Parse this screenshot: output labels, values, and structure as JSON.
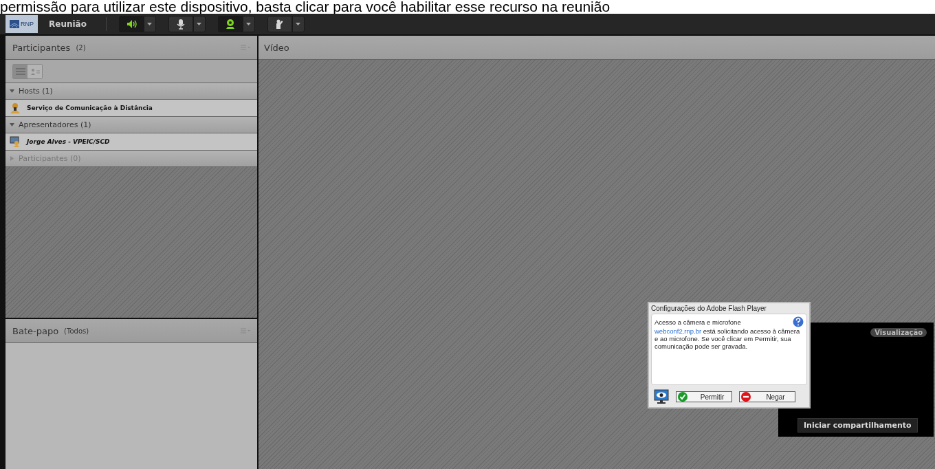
{
  "banner": "permissão para utilizar este dispositivo, basta clicar para você habilitar esse recurso na reunião",
  "toolbar": {
    "logo": "RNP",
    "menu": "Reunião",
    "buttons": [
      {
        "kind": "speaker",
        "on": true
      },
      {
        "kind": "mic",
        "on": false
      },
      {
        "kind": "camera",
        "on": true
      },
      {
        "kind": "hand",
        "on": false
      }
    ]
  },
  "participants": {
    "title": "Participantes",
    "count": "(2)",
    "view_toggle": [
      {
        "kind": "list",
        "selected": true
      },
      {
        "kind": "card",
        "selected": false
      }
    ],
    "groups": [
      {
        "label": "Hosts (1)",
        "expanded": true,
        "members": [
          {
            "name": "Serviço de Comunicação à Distância",
            "kind": "host",
            "italic": false
          }
        ]
      },
      {
        "label": "Apresentadores (1)",
        "expanded": true,
        "members": [
          {
            "name": "Jorge Alves - VPEIC/SCD",
            "kind": "presenter",
            "italic": true
          }
        ]
      },
      {
        "label": "Participantes (0)",
        "expanded": false
      }
    ]
  },
  "chat": {
    "title": "Bate-papo",
    "scope": "(Todos)"
  },
  "video": {
    "title": "Vídeo",
    "preview_label": "Visualização",
    "share_button": "Iniciar compartilhamento"
  },
  "flash_dialog": {
    "title": "Configurações do Adobe Flash Player",
    "heading": "Acesso a câmera e microfone",
    "link": "webconf2.rnp.br",
    "message": " está solicitando acesso à câmera e ao microfone. Se você clicar em Permitir, sua comunicação pode ser gravada.",
    "allow": "Permitir",
    "deny": "Negar"
  }
}
